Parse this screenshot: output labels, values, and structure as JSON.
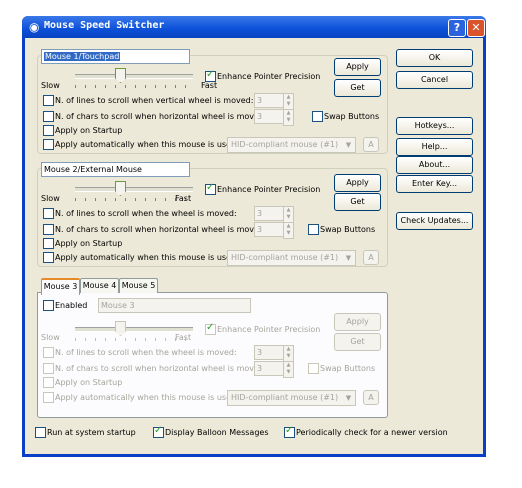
{
  "window": {
    "title": "Mouse Speed Switcher"
  },
  "buttons": {
    "ok": "OK",
    "cancel": "Cancel",
    "hotkeys": "Hotkeys...",
    "help": "Help...",
    "about": "About...",
    "enter_key": "Enter Key...",
    "check_updates": "Check Updates..."
  },
  "mice": [
    {
      "name": "Mouse 1/Touchpad",
      "slow": "Slow",
      "fast": "Fast",
      "enhance_label": "Enhance Pointer Precision",
      "enhance_checked": true,
      "apply": "Apply",
      "get": "Get",
      "lines_label": "N. of lines to scroll when vertical wheel is moved:",
      "lines_value": "3",
      "chars_label": "N. of chars to scroll when  horizontal wheel is moved:",
      "chars_value": "3",
      "swap_label": "Swap Buttons",
      "startup_label": "Apply on Startup",
      "auto_label": "Apply automatically when this mouse is used:",
      "device": "HID-compliant mouse (#1)",
      "a_btn": "A",
      "speed_value": 0.5
    },
    {
      "name": "Mouse 2/External Mouse",
      "slow": "Slow",
      "fast": "Fast",
      "enhance_label": "Enhance Pointer Precision",
      "enhance_checked": true,
      "apply": "Apply",
      "get": "Get",
      "lines_label": "N. of lines to scroll when the wheel is moved:",
      "lines_value": "3",
      "chars_label": "N. of chars to scroll when  horizontal wheel is moved:",
      "chars_value": "3",
      "swap_label": "Swap Buttons",
      "startup_label": "Apply on Startup",
      "auto_label": "Apply automatically when this mouse is used:",
      "device": "HID-compliant mouse (#1)",
      "a_btn": "A",
      "speed_value": 0.5
    }
  ],
  "tabs": [
    "Mouse 3",
    "Mouse 4",
    "Mouse 5"
  ],
  "mouse3": {
    "enabled_label": "Enabled",
    "name_placeholder": "Mouse 3",
    "slow": "Slow",
    "fast": "Fast",
    "enhance_label": "Enhance Pointer Precision",
    "apply": "Apply",
    "get": "Get",
    "lines_label": "N. of lines to scroll when the wheel is moved:",
    "lines_value": "3",
    "chars_label": "N. of chars to scroll when  horizontal wheel is moved:",
    "chars_value": "3",
    "swap_label": "Swap Buttons",
    "startup_label": "Apply on Startup",
    "auto_label": "Apply automatically when this mouse is used:",
    "device": "HID-compliant mouse (#1)",
    "a_btn": "A",
    "speed_value": 0.5
  },
  "footer": {
    "run_startup": "Run at system startup",
    "balloon": "Display Balloon Messages",
    "check_newer": "Periodically check for a newer version"
  }
}
